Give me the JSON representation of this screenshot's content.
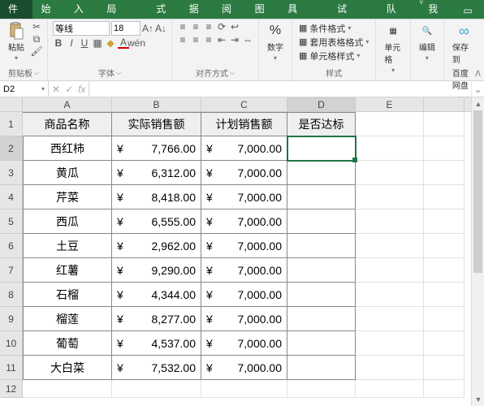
{
  "tabs": {
    "file": "文件",
    "home": "开始",
    "insert": "插入",
    "pagelayout": "页面布局",
    "formulas": "公式",
    "data": "数据",
    "review": "审阅",
    "view": "视图",
    "developer": "开发工具",
    "loadtest": "负载测试",
    "team": "团队",
    "tellme": "告诉我"
  },
  "ribbon": {
    "clipboard": {
      "label": "剪贴板",
      "paste": "粘贴"
    },
    "font": {
      "label": "字体",
      "name": "等线",
      "size": "18"
    },
    "align": {
      "label": "对齐方式"
    },
    "number": {
      "label": "数字",
      "btn": "数字"
    },
    "styles": {
      "label": "样式",
      "cond": "条件格式",
      "table": "套用表格格式",
      "cell": "单元格样式"
    },
    "cells": {
      "label": "单元格"
    },
    "editing": {
      "label": "编辑"
    },
    "save": {
      "label": "保存",
      "line1": "保存到",
      "line2": "百度网盘"
    }
  },
  "namebox": "D2",
  "sheet": {
    "columns": [
      "A",
      "B",
      "C",
      "D",
      "E"
    ],
    "headers": {
      "A": "商品名称",
      "B": "实际销售额",
      "C": "计划销售额",
      "D": "是否达标"
    },
    "rows": [
      {
        "n": "2",
        "name": "西红柿",
        "actual": "7,766.00",
        "plan": "7,000.00"
      },
      {
        "n": "3",
        "name": "黄瓜",
        "actual": "6,312.00",
        "plan": "7,000.00"
      },
      {
        "n": "4",
        "name": "芹菜",
        "actual": "8,418.00",
        "plan": "7,000.00"
      },
      {
        "n": "5",
        "name": "西瓜",
        "actual": "6,555.00",
        "plan": "7,000.00"
      },
      {
        "n": "6",
        "name": "土豆",
        "actual": "2,962.00",
        "plan": "7,000.00"
      },
      {
        "n": "7",
        "name": "红薯",
        "actual": "9,290.00",
        "plan": "7,000.00"
      },
      {
        "n": "8",
        "name": "石榴",
        "actual": "4,344.00",
        "plan": "7,000.00"
      },
      {
        "n": "9",
        "name": "榴莲",
        "actual": "8,277.00",
        "plan": "7,000.00"
      },
      {
        "n": "10",
        "name": "葡萄",
        "actual": "4,537.00",
        "plan": "7,000.00"
      },
      {
        "n": "11",
        "name": "大白菜",
        "actual": "7,532.00",
        "plan": "7,000.00"
      }
    ],
    "currency": "¥"
  }
}
